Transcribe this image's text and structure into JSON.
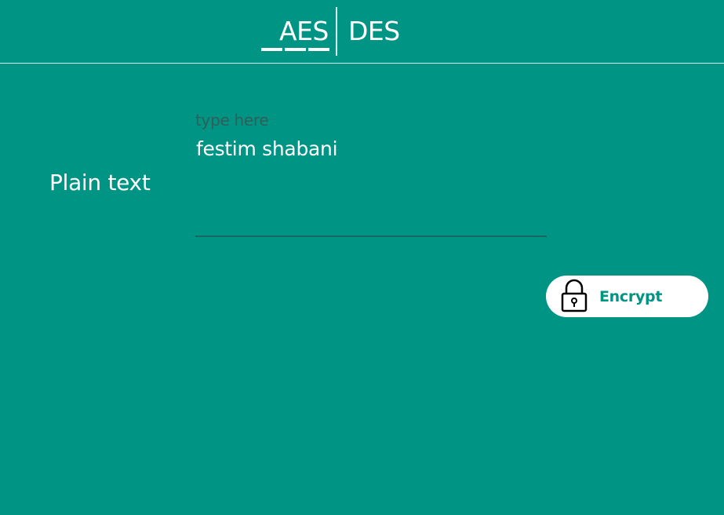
{
  "tabs": {
    "aes_label": "AES",
    "des_label": "DES",
    "selected": "AES"
  },
  "form": {
    "plain_text_label": "Plain text",
    "input_placeholder": "type here",
    "input_value": "festim shabani"
  },
  "actions": {
    "encrypt_label": "Encrypt",
    "encrypt_icon": "lock-icon"
  },
  "colors": {
    "background": "#009485",
    "text": "#ffffff",
    "button_background": "#ffffff",
    "button_text": "#009485"
  }
}
